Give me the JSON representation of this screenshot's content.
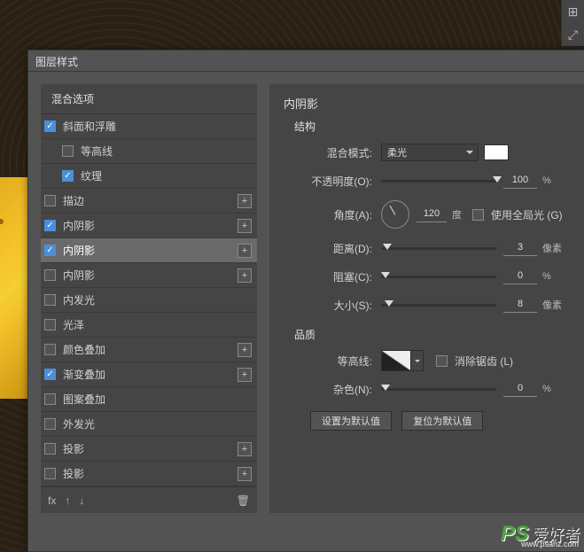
{
  "dialog": {
    "title": "图层样式",
    "blending_header": "混合选项",
    "effects": [
      {
        "key": "bevel",
        "label": "斜面和浮雕",
        "checked": true,
        "plus": false,
        "sub": false
      },
      {
        "key": "contour",
        "label": "等高线",
        "checked": false,
        "plus": false,
        "sub": true
      },
      {
        "key": "texture",
        "label": "纹理",
        "checked": true,
        "plus": false,
        "sub": true
      },
      {
        "key": "stroke",
        "label": "描边",
        "checked": false,
        "plus": true,
        "sub": false
      },
      {
        "key": "inner-shadow-1",
        "label": "内阴影",
        "checked": true,
        "plus": true,
        "sub": false
      },
      {
        "key": "inner-shadow-2",
        "label": "内阴影",
        "checked": true,
        "plus": true,
        "sub": false,
        "selected": true
      },
      {
        "key": "inner-shadow-3",
        "label": "内阴影",
        "checked": false,
        "plus": true,
        "sub": false
      },
      {
        "key": "inner-glow",
        "label": "内发光",
        "checked": false,
        "plus": false,
        "sub": false
      },
      {
        "key": "satin",
        "label": "光泽",
        "checked": false,
        "plus": false,
        "sub": false
      },
      {
        "key": "color-overlay",
        "label": "颜色叠加",
        "checked": false,
        "plus": true,
        "sub": false
      },
      {
        "key": "gradient-overlay",
        "label": "渐变叠加",
        "checked": true,
        "plus": true,
        "sub": false
      },
      {
        "key": "pattern-overlay",
        "label": "图案叠加",
        "checked": false,
        "plus": false,
        "sub": false
      },
      {
        "key": "outer-glow",
        "label": "外发光",
        "checked": false,
        "plus": false,
        "sub": false
      },
      {
        "key": "drop-shadow-1",
        "label": "投影",
        "checked": false,
        "plus": true,
        "sub": false
      },
      {
        "key": "drop-shadow-2",
        "label": "投影",
        "checked": false,
        "plus": true,
        "sub": false
      }
    ],
    "footer": {
      "fx": "fx"
    }
  },
  "panel": {
    "title": "内阴影",
    "structure_label": "结构",
    "blend_mode_label": "混合模式:",
    "blend_mode_value": "柔光",
    "opacity_label": "不透明度(O):",
    "opacity_value": "100",
    "opacity_unit": "%",
    "angle_label": "角度(A):",
    "angle_value": "120",
    "angle_unit": "度",
    "global_light_label": "使用全局光 (G)",
    "distance_label": "距离(D):",
    "distance_value": "3",
    "distance_unit": "像素",
    "choke_label": "阻塞(C):",
    "choke_value": "0",
    "choke_unit": "%",
    "size_label": "大小(S):",
    "size_value": "8",
    "size_unit": "像素",
    "quality_label": "品质",
    "contour_label": "等高线:",
    "antialias_label": "消除锯齿 (L)",
    "noise_label": "杂色(N):",
    "noise_value": "0",
    "noise_unit": "%",
    "set_default": "设置为默认值",
    "reset_default": "复位为默认值"
  },
  "watermark": {
    "ps": "PS",
    "cn": "爱好者",
    "url": "www.psahz.com"
  }
}
